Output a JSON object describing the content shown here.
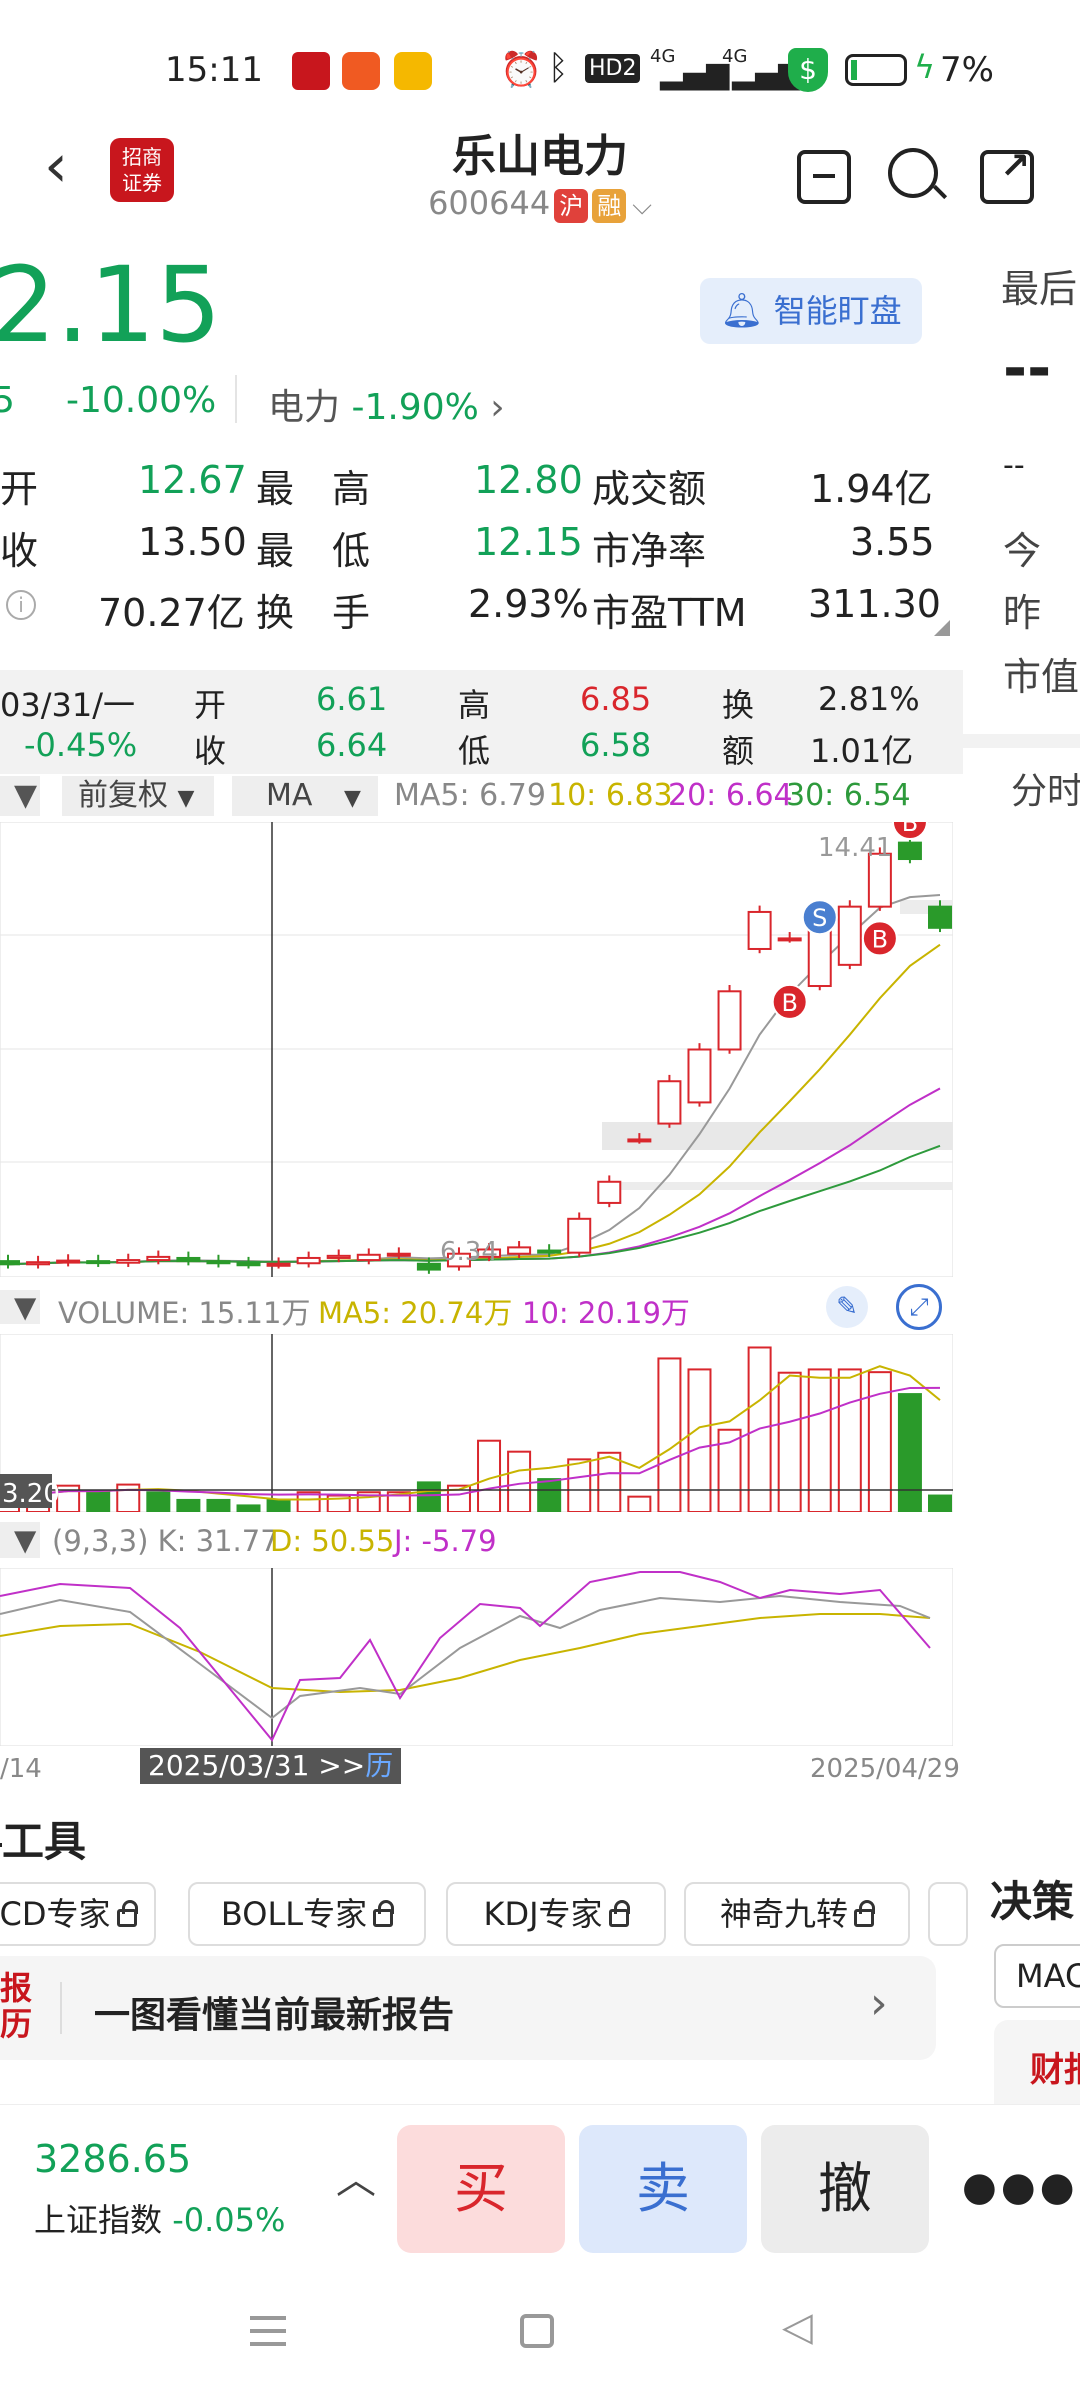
{
  "status_bar": {
    "time": "15:11",
    "hd": "HD2",
    "net1": "4G",
    "net2": "4G",
    "battery": "7%"
  },
  "header": {
    "title": "乐山电力",
    "code": "600644",
    "tag_sh": "沪",
    "tag_rong": "融"
  },
  "quote": {
    "price": "2.15",
    "change_partial": "5",
    "change_pct": "-10.00%",
    "sector_label": "电力",
    "sector_pct": "-1.90%",
    "smart_watch": "智能盯盘"
  },
  "stats": [
    {
      "l1": "开",
      "v1": "12.67",
      "l2": "最　高",
      "v2": "12.80",
      "l3": "成交额",
      "v3": "1.94亿"
    },
    {
      "l1": "收",
      "v1": "13.50",
      "l2": "最　低",
      "v2": "12.15",
      "l3": "市净率",
      "v3": "3.55"
    },
    {
      "l1": "",
      "v1": "70.27亿",
      "l2": "换　手",
      "v2": "2.93%",
      "l3": "市盈TTM",
      "v3": "311.30"
    }
  ],
  "right_panel": {
    "title": "最后",
    "dash": "--",
    "dash2": "--",
    "today": "今",
    "yesterday": "昨",
    "mktcap": "市值",
    "fenshi": "分时"
  },
  "day_info": {
    "date": "03/31/一",
    "pct": "-0.45%",
    "open_l": "开",
    "open_v": "6.61",
    "close_l": "收",
    "close_v": "6.64",
    "high_l": "高",
    "high_v": "6.85",
    "low_l": "低",
    "low_v": "6.58",
    "turn_l": "换",
    "turn_v": "2.81%",
    "amt_l": "额",
    "amt_v": "1.01亿"
  },
  "toolbar": {
    "adj": "前复权",
    "ind": "MA",
    "ma5": "MA5: 6.79",
    "ma10": "10: 6.83",
    "ma20": "20: 6.64",
    "ma30": "30: 6.54"
  },
  "kline": {
    "high_label": "14.41",
    "low_label": "6.34",
    "marker_b": "B",
    "marker_s": "S"
  },
  "volume": {
    "label": "VOLUME: 15.11万",
    "ma5": "MA5: 20.74万",
    "ma10": "10: 20.19万",
    "axis": "3.20"
  },
  "kdj": {
    "label": "(9,3,3) K: 31.77",
    "d": "D: 50.55",
    "j": "J: -5.79"
  },
  "dates": {
    "left": "/14",
    "cursor": "2025/03/31 >>",
    "cursor_suffix": "历",
    "right": "2025/04/29"
  },
  "tools": {
    "title": "工具",
    "items": [
      "CD专家",
      "BOLL专家",
      "KDJ专家",
      "神奇九转"
    ]
  },
  "report": {
    "icon_text": "报\n历",
    "text": "一图看懂当前最新报告"
  },
  "side": {
    "title": "决策",
    "chip": "MAC",
    "logo": "财报"
  },
  "bottom": {
    "index_value": "3286.65",
    "index_name": "上证指数",
    "index_pct": "-0.05%",
    "buy": "买",
    "sell": "卖",
    "cancel": "撤"
  },
  "chart_data": {
    "type": "candlestick",
    "candles": [
      {
        "o": 6.5,
        "c": 6.44
      },
      {
        "o": 6.44,
        "c": 6.48
      },
      {
        "o": 6.48,
        "c": 6.51
      },
      {
        "o": 6.5,
        "c": 6.47
      },
      {
        "o": 6.47,
        "c": 6.52
      },
      {
        "o": 6.52,
        "c": 6.58
      },
      {
        "o": 6.56,
        "c": 6.5
      },
      {
        "o": 6.5,
        "c": 6.46
      },
      {
        "o": 6.46,
        "c": 6.44
      },
      {
        "o": 6.44,
        "c": 6.45
      },
      {
        "o": 6.46,
        "c": 6.56
      },
      {
        "o": 6.56,
        "c": 6.6
      },
      {
        "o": 6.52,
        "c": 6.62
      },
      {
        "o": 6.62,
        "c": 6.64
      },
      {
        "o": 6.45,
        "c": 6.34
      },
      {
        "o": 6.4,
        "c": 6.64
      },
      {
        "o": 6.58,
        "c": 6.72
      },
      {
        "o": 6.64,
        "c": 6.76
      },
      {
        "o": 6.7,
        "c": 6.66
      },
      {
        "o": 6.66,
        "c": 7.3
      },
      {
        "o": 7.6,
        "c": 8.0
      },
      {
        "o": 8.8,
        "c": 8.8
      },
      {
        "o": 9.1,
        "c": 9.9
      },
      {
        "o": 9.5,
        "c": 10.5
      },
      {
        "o": 10.5,
        "c": 11.6
      },
      {
        "o": 12.4,
        "c": 13.1
      },
      {
        "o": 12.6,
        "c": 12.6
      },
      {
        "o": 11.7,
        "c": 12.8
      },
      {
        "o": 12.1,
        "c": 13.2
      },
      {
        "o": 13.2,
        "c": 14.2
      },
      {
        "o": 14.41,
        "c": 14.1
      },
      {
        "o": 13.2,
        "c": 12.8
      }
    ],
    "volume": [
      3.0,
      3.6,
      4.8,
      3.8,
      5.0,
      3.6,
      2.2,
      2.2,
      1.2,
      2.2,
      3.6,
      3.0,
      3.6,
      3.6,
      5.4,
      4.8,
      13.0,
      11.0,
      6.0,
      9.6,
      10.8,
      2.8,
      28.0,
      26.0,
      15.0,
      30.0,
      25.4,
      26.0,
      26.0,
      25.5,
      21.5,
      3.0
    ],
    "vol_up": [
      1,
      1,
      1,
      0,
      1,
      0,
      0,
      0,
      0,
      0,
      1,
      1,
      1,
      1,
      0,
      1,
      1,
      1,
      0,
      1,
      1,
      1,
      1,
      1,
      1,
      1,
      1,
      1,
      1,
      1,
      0,
      0
    ],
    "price_range": [
      6.2,
      14.8
    ],
    "volume_range": [
      0,
      31
    ]
  }
}
